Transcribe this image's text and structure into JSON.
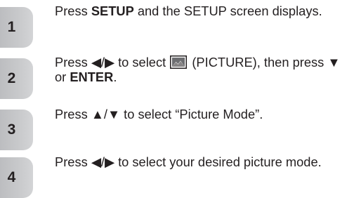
{
  "steps": [
    {
      "number": "1",
      "t1": "Press ",
      "b1": "SETUP",
      "t2": " and the SETUP screen displays."
    },
    {
      "number": "2",
      "t1": "Press ",
      "arrows": "◀/▶",
      "t2": " to select ",
      "icon": "picture-icon",
      "t3": " (PICTURE), then press ",
      "arrow_down": "▼",
      "t4": " or ",
      "b1": "ENTER",
      "t5": "."
    },
    {
      "number": "3",
      "t1": "Press ",
      "arrows": "▲/▼",
      "t2": " to select “Picture Mode”."
    },
    {
      "number": "4",
      "t1": "Press ",
      "arrows": "◀/▶",
      "t2": " to select your desired picture mode."
    }
  ],
  "colors": {
    "badge": "#c6c7c9",
    "text": "#231f20"
  }
}
